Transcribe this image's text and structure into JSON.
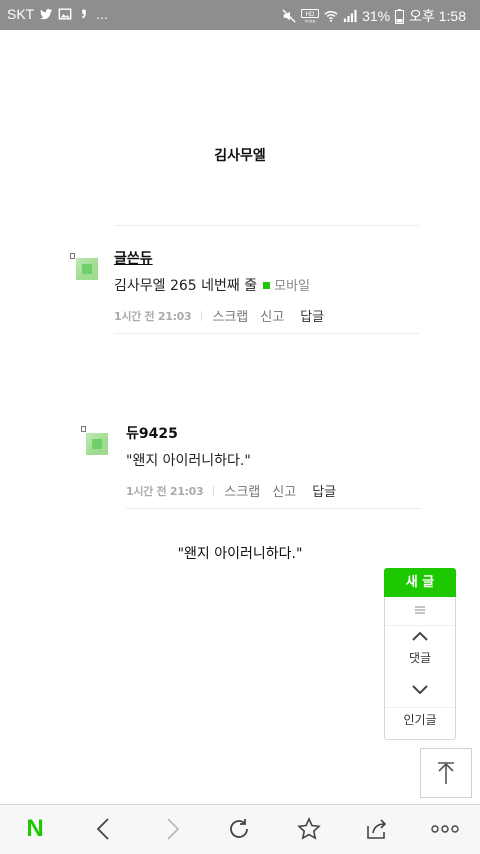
{
  "status_bar": {
    "carrier": "SKT",
    "ellipsis": "...",
    "battery": "31%",
    "time": "오후 1:58"
  },
  "page": {
    "title": "김사무엘"
  },
  "comments": [
    {
      "author": "글쓴듀",
      "text": "김사무엘 265 네번째 줄",
      "badge": "모바일",
      "time": "1시간 전  21:03",
      "actions": [
        "스크랩",
        "신고",
        "답글"
      ]
    },
    {
      "author": "듀9425",
      "text": "\"왠지 아이러니하다.\"",
      "time": "1시간 전  21:03",
      "actions": [
        "스크랩",
        "신고",
        "답글"
      ]
    }
  ],
  "quote": "\"왠지 아이러니하다.\"",
  "float_panel": {
    "new_post": "새 글",
    "comments": "댓글",
    "popular": "인기글"
  },
  "bottom_nav": {
    "logo": "N",
    "icons": [
      "back-icon",
      "forward-icon",
      "reload-icon",
      "bookmark-icon",
      "share-icon",
      "more-icon"
    ]
  },
  "colors": {
    "brand": "#1ec800",
    "status_bar": "#8e8e8e"
  }
}
